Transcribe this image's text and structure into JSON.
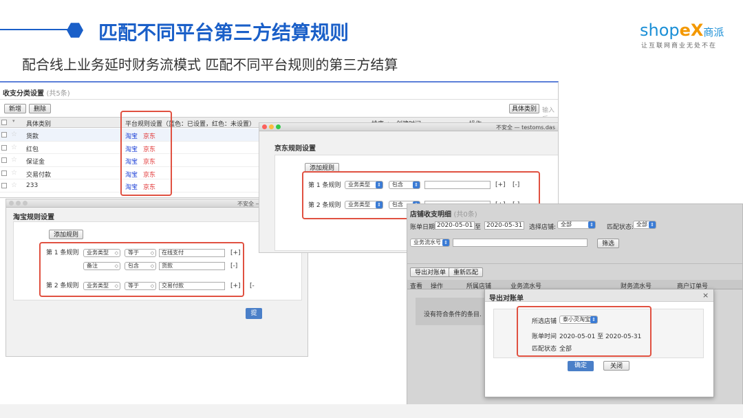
{
  "header": {
    "title": "匹配不同平台第三方结算规则",
    "subtitle": "配合线上业务延时财务流模式 匹配不同平台规则的第三方结算",
    "logo_main": "shop",
    "logo_x": "eX",
    "logo_cn": "商派",
    "logo_slogan": "让互联网商业无处不在"
  },
  "colors": {
    "accent": "#1a5fc8",
    "highlight_box": "#e05040",
    "taobao": "#1b3fd6",
    "jd": "#e03030"
  },
  "category_list": {
    "title": "收支分类设置",
    "count": "(共5条)",
    "buttons": {
      "add": "新增",
      "delete": "删除"
    },
    "filter_select": "具体类别",
    "filter_placeholder": "输入后",
    "columns": {
      "category": "具体类别",
      "rule": "平台规则设置（蓝色：已设置，红色：未设置）",
      "sort": "排序 ▲",
      "created": "创建时间",
      "ops": "操作"
    },
    "rows": [
      {
        "name": "货款",
        "taobao": "淘宝",
        "jd": "京东"
      },
      {
        "name": "红包",
        "taobao": "淘宝",
        "jd": "京东"
      },
      {
        "name": "保证金",
        "taobao": "淘宝",
        "jd": "京东"
      },
      {
        "name": "交易付款",
        "taobao": "淘宝",
        "jd": "京东"
      },
      {
        "name": "233",
        "taobao": "淘宝",
        "jd": "京东"
      }
    ]
  },
  "taobao_window": {
    "titlebar_text": "不安全 —",
    "title": "淘宝规则设置",
    "add_rule": "添加规则",
    "rule1_label": "第 1 条规则",
    "rule2_label": "第 2 条规则",
    "rule1": [
      {
        "field": "业务类型",
        "op": "等于",
        "value": "在线支付",
        "action": "[+]"
      },
      {
        "field": "备注",
        "op": "包含",
        "value": "货款",
        "action": "[-]"
      }
    ],
    "rule2": {
      "field": "业务类型",
      "op": "等于",
      "value": "交易付款",
      "action": "[+]",
      "action2": "[-"
    },
    "submit": "提"
  },
  "jd_window": {
    "titlebar_text": "不安全 — testoms.das",
    "title": "京东规则设置",
    "add_rule": "添加规则",
    "rule1_label": "第 1 条规则",
    "rule2_label": "第 2 条规则",
    "rule1": {
      "field": "业务类型",
      "op": "包含",
      "plus": "[+]",
      "minus": "[-]"
    },
    "rule2": {
      "field": "业务类型",
      "op": "包含",
      "plus": "[+]",
      "minus": "[-]"
    }
  },
  "match_window": {
    "title": "店铺收支明细",
    "count": "(共0条)",
    "date_label": "账单日期:",
    "date_from": "2020-05-01",
    "date_to_label": "至",
    "date_to": "2020-05-31",
    "shop_label": "选择店铺:",
    "shop_value": "全部",
    "match_label": "匹配状态:",
    "match_value": "全部",
    "flow_select": "业务流水号",
    "filter_btn": "筛选",
    "export_btn": "导出对账单",
    "rematch_btn": "重新匹配",
    "columns": [
      "查看",
      "操作",
      "所属店铺",
      "业务流水号",
      "财务流水号",
      "商户订单号"
    ],
    "empty": "没有符合条件的条目."
  },
  "export_dialog": {
    "title": "导出对账单",
    "close": "×",
    "shop_label": "所选店铺",
    "shop_value": "泰小灵淘宝",
    "time_label": "账单时间",
    "time_value": "2020-05-01 至 2020-05-31",
    "status_label": "匹配状态",
    "status_value": "全部",
    "confirm": "确定",
    "cancel": "关闭"
  }
}
